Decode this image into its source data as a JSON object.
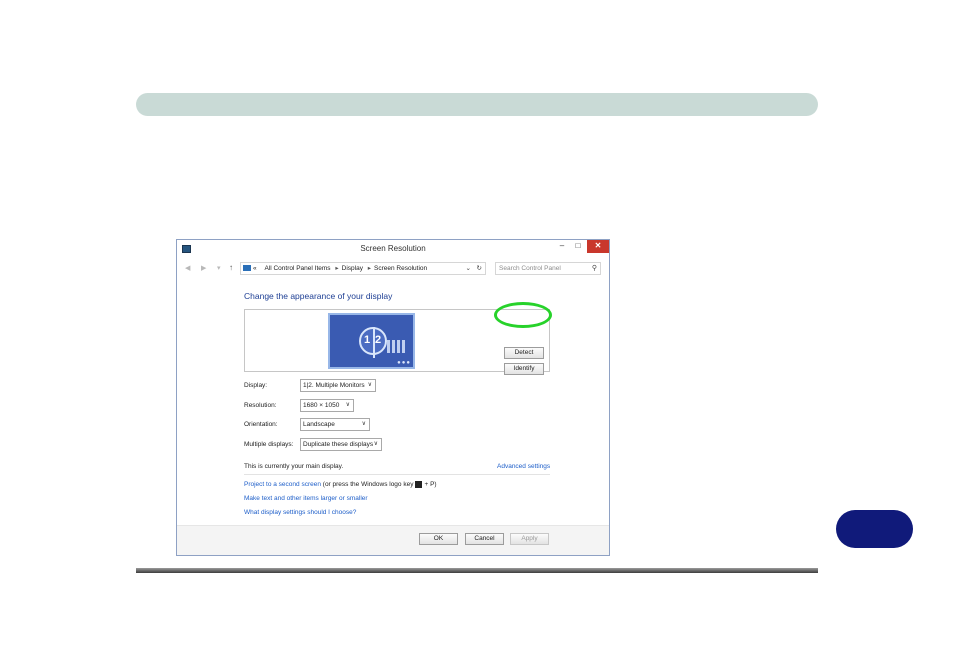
{
  "colors": {
    "accent_link": "#1d5ec9",
    "heading": "#1e3f94",
    "highlight_ring": "#27d22a",
    "page_tab": "#101a7a",
    "top_band": "#c9dad6"
  },
  "window": {
    "title": "Screen Resolution",
    "controls": {
      "minimize": "–",
      "maximize": "□",
      "close": "✕"
    }
  },
  "address_bar": {
    "breadcrumbs": [
      "«",
      "All Control Panel Items",
      "Display",
      "Screen Resolution"
    ],
    "separator": "▸",
    "search_placeholder": "Search Control Panel"
  },
  "main": {
    "heading": "Change the appearance of your display",
    "preview": {
      "monitor_labels": [
        "1",
        "2"
      ]
    },
    "buttons": {
      "detect": "Detect",
      "identify": "Identify"
    },
    "fields": [
      {
        "label": "Display:",
        "value": "1|2. Multiple Monitors"
      },
      {
        "label": "Resolution:",
        "value": "1680 × 1050"
      },
      {
        "label": "Orientation:",
        "value": "Landscape"
      },
      {
        "label": "Multiple displays:",
        "value": "Duplicate these displays"
      }
    ],
    "main_display_note": "This is currently your main display.",
    "advanced_link": "Advanced settings",
    "links": {
      "project_link": "Project to a second screen",
      "project_suffix_before": "(or press the Windows logo key",
      "project_suffix_after": "+ P)",
      "text_size": "Make text and other items larger or smaller",
      "what_settings": "What display settings should I choose?"
    }
  },
  "footer": {
    "ok": "OK",
    "cancel": "Cancel",
    "apply": "Apply"
  }
}
